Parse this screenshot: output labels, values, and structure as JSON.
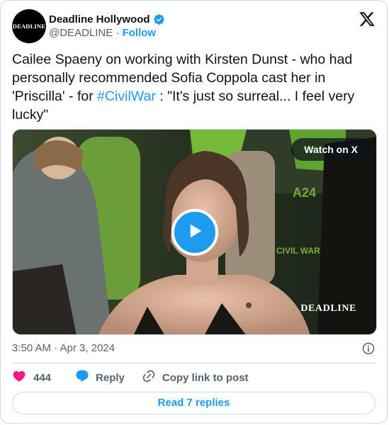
{
  "author": {
    "avatar_text": "DEADLINE",
    "display_name": "Deadline Hollywood",
    "handle": "@DEADLINE",
    "separator": " · ",
    "follow_label": "Follow",
    "verified_icon": "verified-badge-icon"
  },
  "platform_icon": "x-logo-icon",
  "tweet": {
    "text_before": "Cailee Spaeny on working with Kirsten Dunst - who had personally recommended Sofia Coppola cast her in 'Priscilla' - for ",
    "hashtag": "#CivilWar",
    "text_after": " : \"It's just so surreal... I feel very lucky\""
  },
  "media": {
    "watch_label": "Watch on X",
    "watermark": "DEADLINE",
    "play_icon": "play-icon",
    "backdrop_text_1": "CIVIL WAR",
    "backdrop_text_2": "A24"
  },
  "meta": {
    "timestamp": "3:50 AM · Apr 3, 2024",
    "info_icon": "info-icon"
  },
  "actions": {
    "like_count": "444",
    "reply_label": "Reply",
    "copy_label": "Copy link to post"
  },
  "read_replies_label": "Read 7 replies",
  "colors": {
    "accent": "#1d9bf0",
    "like": "#f91880",
    "text": "#0f1419",
    "secondary": "#536471",
    "border": "#cfd9de"
  }
}
